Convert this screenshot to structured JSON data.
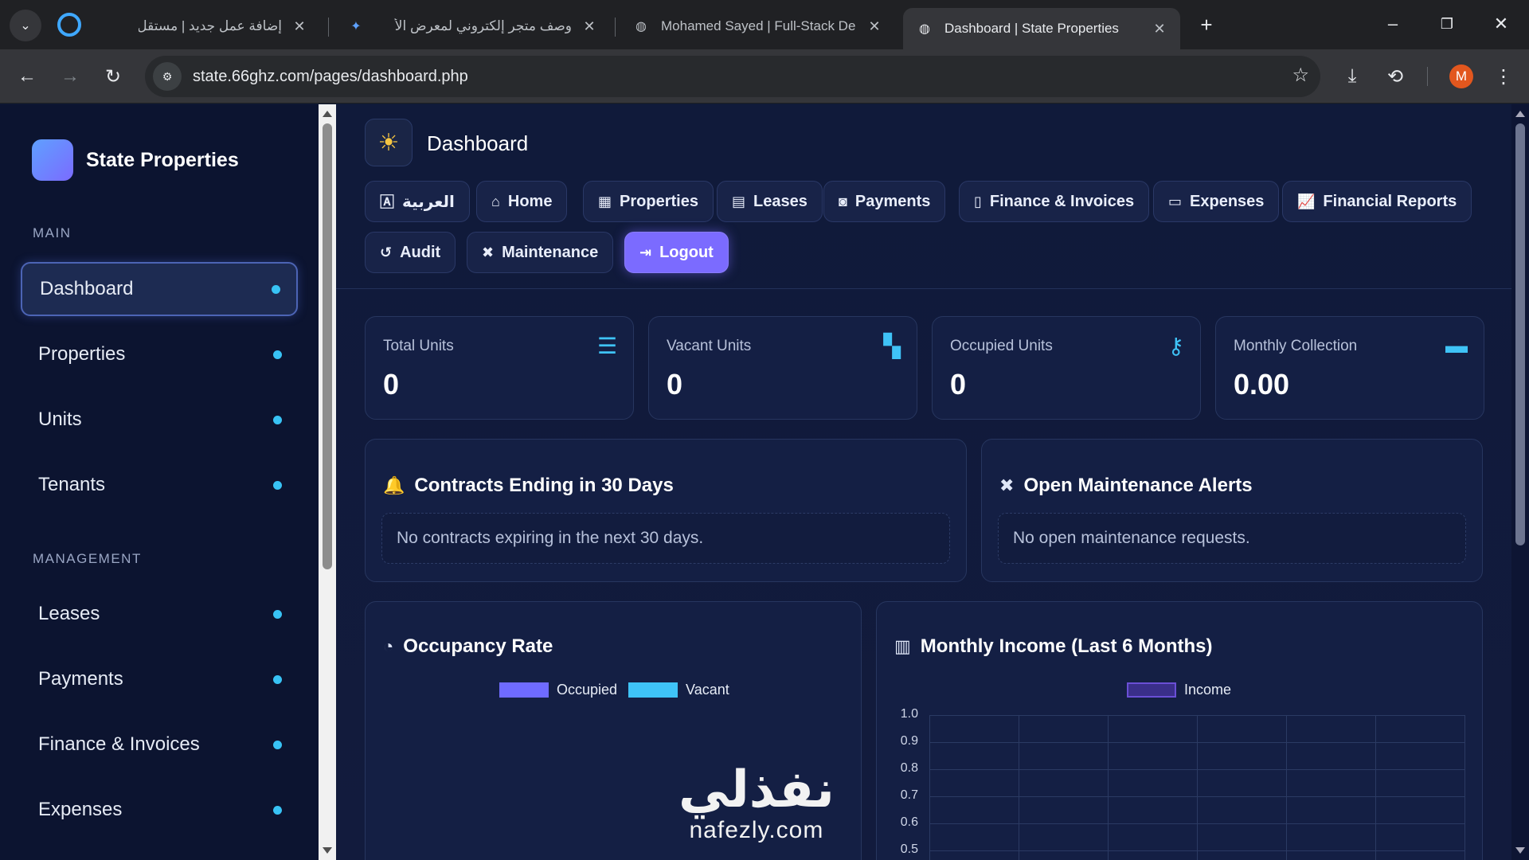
{
  "browser": {
    "tabs": [
      {
        "title": "إضافة عمل جديد | مستقل",
        "icon": "globe-icon"
      },
      {
        "title": "وصف متجر إلكتروني لمعرض الأ",
        "icon": "gemini-sparkle-icon"
      },
      {
        "title": "Mohamed Sayed | Full-Stack De",
        "icon": "globe-icon"
      },
      {
        "title": "Dashboard | State Properties",
        "icon": "globe-icon"
      }
    ],
    "url": "state.66ghz.com/pages/dashboard.php",
    "profile_initial": "M"
  },
  "sidebar": {
    "brand": "State Properties",
    "section_main": "MAIN",
    "section_management": "MANAGEMENT",
    "main_items": [
      {
        "label": "Dashboard",
        "active": true
      },
      {
        "label": "Properties"
      },
      {
        "label": "Units"
      },
      {
        "label": "Tenants"
      }
    ],
    "management_items": [
      {
        "label": "Leases"
      },
      {
        "label": "Payments"
      },
      {
        "label": "Finance & Invoices"
      },
      {
        "label": "Expenses"
      }
    ]
  },
  "header": {
    "title": "Dashboard",
    "nav": [
      {
        "label": "العربية",
        "icon": "language-icon"
      },
      {
        "label": "Home",
        "icon": "home-icon"
      },
      {
        "label": "Properties",
        "icon": "building-icon"
      },
      {
        "label": "Leases",
        "icon": "document-icon"
      },
      {
        "label": "Payments",
        "icon": "money-icon"
      },
      {
        "label": "Finance & Invoices",
        "icon": "invoice-icon"
      },
      {
        "label": "Expenses",
        "icon": "wallet-icon"
      },
      {
        "label": "Financial Reports",
        "icon": "chart-line-icon"
      },
      {
        "label": "Audit",
        "icon": "history-icon"
      },
      {
        "label": "Maintenance",
        "icon": "tools-icon"
      },
      {
        "label": "Logout",
        "icon": "logout-icon"
      }
    ]
  },
  "stats": [
    {
      "label": "Total Units",
      "value": "0",
      "icon": "layers-icon"
    },
    {
      "label": "Vacant Units",
      "value": "0",
      "icon": "door-open-icon"
    },
    {
      "label": "Occupied Units",
      "value": "0",
      "icon": "key-icon"
    },
    {
      "label": "Monthly Collection",
      "value": "0.00",
      "icon": "wallet-icon"
    }
  ],
  "panels": {
    "contracts": {
      "title": "Contracts Ending in 30 Days",
      "empty": "No contracts expiring in the next 30 days."
    },
    "maintenance": {
      "title": "Open Maintenance Alerts",
      "empty": "No open maintenance requests."
    }
  },
  "charts_titles": {
    "occupancy": "Occupancy Rate",
    "income": "Monthly Income (Last 6 Months)"
  },
  "colors": {
    "accent": "#7b6bff",
    "occupied": "#6f6bff",
    "vacant": "#3fc3f7",
    "income": "#6a4fd6",
    "dot": "#38c3f5"
  },
  "chart_data": [
    {
      "type": "pie",
      "title": "Occupancy Rate",
      "legend": [
        "Occupied",
        "Vacant"
      ],
      "values": [],
      "legend_position": "top"
    },
    {
      "type": "line",
      "title": "Monthly Income (Last 6 Months)",
      "series": [
        {
          "name": "Income",
          "values": []
        }
      ],
      "yticks": [
        "1.0",
        "0.9",
        "0.8",
        "0.7",
        "0.6",
        "0.5"
      ],
      "legend_position": "top",
      "grid": true
    }
  ],
  "watermark": {
    "ar": "نفذلي",
    "en": "nafezly.com"
  }
}
